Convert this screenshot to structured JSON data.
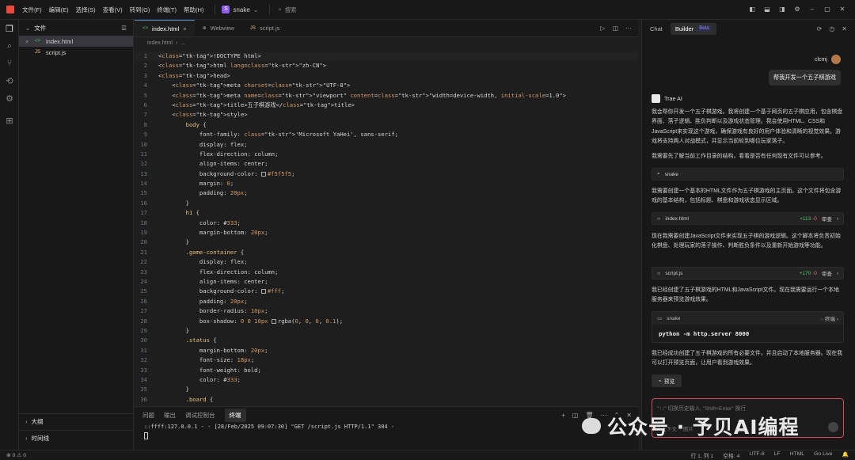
{
  "titlebar": {
    "menus": [
      "文件(F)",
      "编辑(E)",
      "选择(S)",
      "查看(V)",
      "转到(G)",
      "终端(T)",
      "帮助(H)"
    ],
    "project_badge": "S",
    "project_name": "snake",
    "search_placeholder": "搜索"
  },
  "explorer": {
    "title": "文件",
    "files": [
      {
        "name": "index.html",
        "icon": "<>",
        "active": true
      },
      {
        "name": "script.js",
        "icon": "JS",
        "active": false
      }
    ],
    "outline": "大纲",
    "timeline": "时间线"
  },
  "editor": {
    "tabs": [
      {
        "label": "index.html",
        "icon": "<>",
        "active": true
      },
      {
        "label": "Webview",
        "icon": "globe",
        "active": false
      },
      {
        "label": "script.js",
        "icon": "JS",
        "active": false
      }
    ],
    "breadcrumb": [
      "index.html",
      "..."
    ],
    "lines": [
      "<!DOCTYPE html>",
      "<html lang=\"zh-CN\">",
      "<head>",
      "    <meta charset=\"UTF-8\">",
      "    <meta name=\"viewport\" content=\"width=device-width, initial-scale=1.0\">",
      "    <title>五子棋游戏</title>",
      "    <style>",
      "        body {",
      "            font-family: 'Microsoft YaHei', sans-serif;",
      "            display: flex;",
      "            flex-direction: column;",
      "            align-items: center;",
      "            background-color: #f5f5f5;",
      "            margin: 0;",
      "            padding: 20px;",
      "        }",
      "        h1 {",
      "            color: #333;",
      "            margin-bottom: 20px;",
      "        }",
      "        .game-container {",
      "            display: flex;",
      "            flex-direction: column;",
      "            align-items: center;",
      "            background-color: #fff;",
      "            padding: 20px;",
      "            border-radius: 10px;",
      "            box-shadow: 0 0 10px rgba(0, 0, 0, 0.1);",
      "        }",
      "        .status {",
      "            margin-bottom: 20px;",
      "            font-size: 18px;",
      "            font-weight: bold;",
      "            color: #333;",
      "        }",
      "        .board {"
    ]
  },
  "panel": {
    "tabs": [
      "问题",
      "输出",
      "调试控制台",
      "终端"
    ],
    "active_tab": "终端",
    "terminal_line": "::ffff:127.0.0.1 - - [28/Feb/2025 09:07:30] \"GET /script.js HTTP/1.1\" 304 -"
  },
  "ai": {
    "tab_chat": "Chat",
    "tab_builder": "Builder",
    "beta": "Beta",
    "user_name": "clcmj",
    "user_message": "帮我开发一个五子棋游戏",
    "assistant_name": "Trae AI",
    "para1": "我会帮你开发一个五子棋游戏。我将创建一个基于网页的五子棋应用，包含棋盘界面、落子逻辑、胜负判断以及游戏状态管理。我会使用HTML、CSS和JavaScript来实现这个游戏，确保游戏有良好的用户体验和清晰的视觉效果。游戏将支持两人对战模式，并显示当前轮到哪位玩家落子。",
    "para2": "我需要先了解当前工作目录的结构，看看是否有任何现有文件可以参考。",
    "card_search": "snake",
    "para3": "我需要创建一个基本的HTML文件作为五子棋游戏的主页面。这个文件将包含游戏的基本结构，包括标题、棋盘和游戏状态显示区域。",
    "card_index": {
      "name": "index.html",
      "added": "+113",
      "removed": "-0",
      "review": "审查"
    },
    "para4": "现在我需要创建JavaScript文件来实现五子棋的游戏逻辑。这个脚本将负责初始化棋盘、处理玩家的落子操作、判断胜负条件以及重新开始游戏等功能。",
    "card_script": {
      "name": "script.js",
      "added": "+170",
      "removed": "-0",
      "review": "审查"
    },
    "para5": "我已经创建了五子棋游戏的HTML和JavaScript文件。现在我需要运行一个本地服务器来预览游戏效果。",
    "term_card": {
      "folder": "snake",
      "button": "终端",
      "command": "python -m http.server 8000"
    },
    "para6": "我已经成功创建了五子棋游戏的所有必要文件，并且启动了本地服务器。现在我可以打开预览页面，让用户看到游戏效果。",
    "preview_button": "预览",
    "input_placeholder": "\"↑↓\" 切换历史输入, \"Shift+Enter\" 换行",
    "input_tools": [
      "# 上下文",
      "图片"
    ]
  },
  "watermark": "公众号 · 予贝AI编程",
  "statusbar": {
    "left": "⊗ 0 ⚠ 0",
    "position": "行 1, 列 1",
    "spaces": "空格: 4",
    "encoding": "UTF-8",
    "eol": "LF",
    "language": "HTML",
    "golive": "Go Live"
  }
}
